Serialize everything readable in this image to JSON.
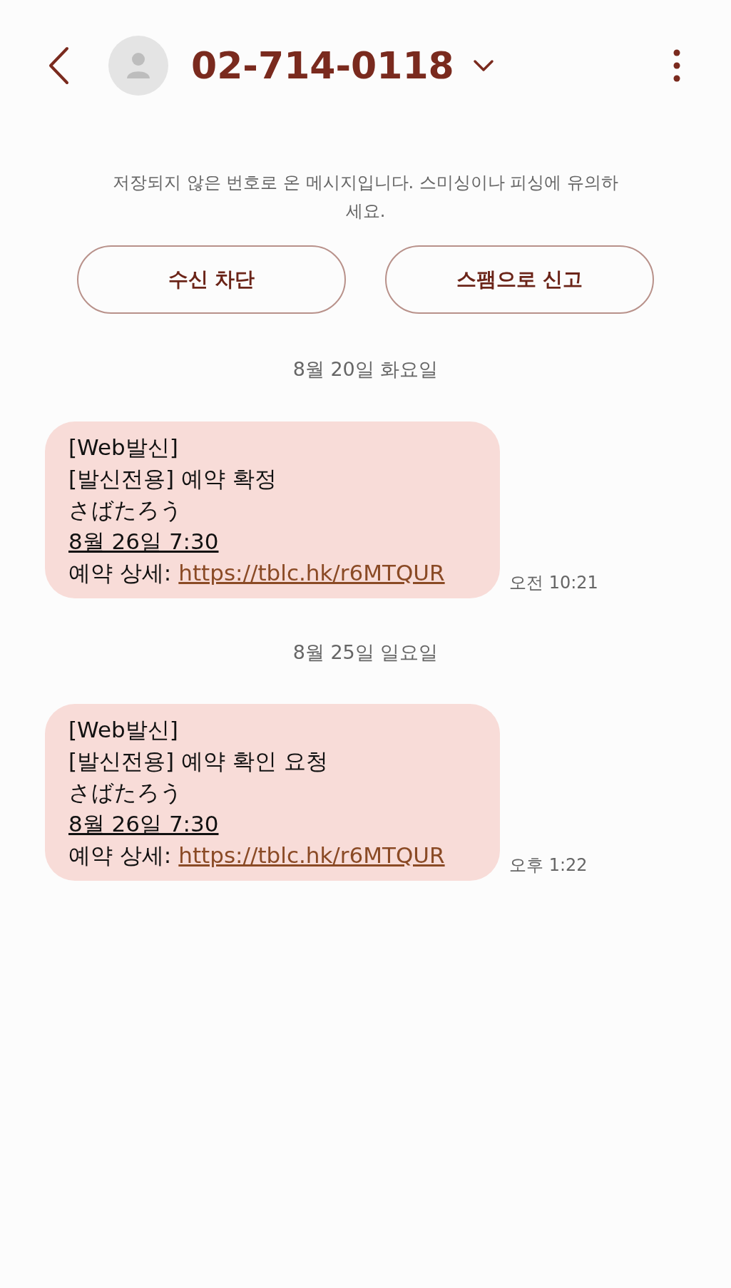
{
  "header": {
    "title": "02-714-0118"
  },
  "notice": "저장되지 않은 번호로 온 메시지입니다. 스미싱이나 피싱에 유의하세요.",
  "buttons": [
    "수신 차단",
    "스팸으로 신고"
  ],
  "conversation": [
    {
      "date": "8월 20일 화요일",
      "time": "오전 10:21",
      "lines": [
        {
          "kind": "plain",
          "text": "[Web발신]"
        },
        {
          "kind": "plain",
          "text": "[발신전용] 예약 확정"
        },
        {
          "kind": "plain",
          "text": "さばたろう"
        },
        {
          "kind": "underlined",
          "text": "8월 26일 7:30"
        },
        {
          "kind": "link",
          "label": "예약 상세:",
          "url": "https://tblc.hk/r6MTQUR"
        }
      ]
    },
    {
      "date": "8월 25일 일요일",
      "time": "오후 1:22",
      "lines": [
        {
          "kind": "plain",
          "text": "[Web발신]"
        },
        {
          "kind": "plain",
          "text": "[발신전용] 예약 확인 요청"
        },
        {
          "kind": "plain",
          "text": "さばたろう"
        },
        {
          "kind": "underlined",
          "text": "8월 26일 7:30"
        },
        {
          "kind": "link",
          "label": "예약 상세:",
          "url": "https://tblc.hk/r6MTQUR"
        }
      ]
    }
  ]
}
